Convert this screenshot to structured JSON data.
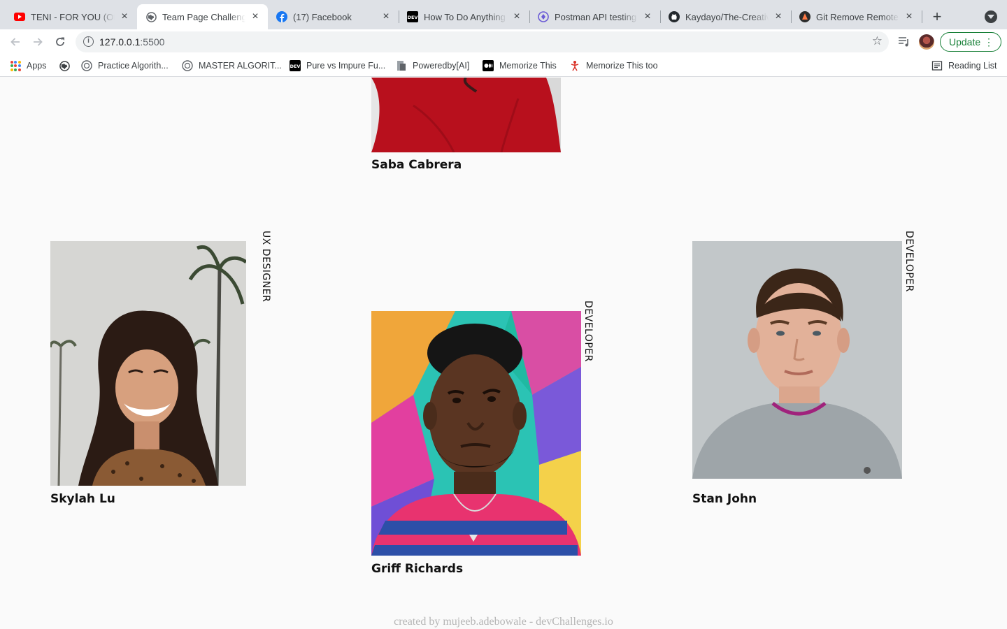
{
  "browser": {
    "tabs": [
      {
        "title": "TENI - FOR YOU (Official",
        "icon": "youtube-icon",
        "active": false
      },
      {
        "title": "Team Page Challenge",
        "icon": "globe-icon",
        "active": true
      },
      {
        "title": "(17) Facebook",
        "icon": "facebook-icon",
        "active": false
      },
      {
        "title": "How To Do Anything in",
        "icon": "dev-icon",
        "active": false
      },
      {
        "title": "Postman API testing w",
        "icon": "postman-icon",
        "active": false
      },
      {
        "title": "Kaydayo/The-Creative",
        "icon": "github-icon",
        "active": false
      },
      {
        "title": "Git Remove Remote: A",
        "icon": "git-icon",
        "active": false
      }
    ],
    "new_tab_label": "+",
    "address": {
      "host": "127.0.0.1",
      "port": ":5500"
    },
    "update_label": "Update",
    "bookmarks": [
      {
        "label": "Apps",
        "icon": "apps-grid-icon"
      },
      {
        "label": "",
        "icon": "globe-icon"
      },
      {
        "label": "Practice Algorith...",
        "icon": "algorithm-icon"
      },
      {
        "label": "MASTER ALGORIT...",
        "icon": "algorithm-icon"
      },
      {
        "label": "Pure vs Impure Fu...",
        "icon": "dev-icon"
      },
      {
        "label": "Poweredby[AI]",
        "icon": "bookmark-page-icon"
      },
      {
        "label": "Memorize This",
        "icon": "medium-icon"
      },
      {
        "label": "Memorize This too",
        "icon": "figure-icon"
      }
    ],
    "reading_list_label": "Reading List"
  },
  "team": {
    "members": [
      {
        "name": "Saba Cabrera",
        "role": ""
      },
      {
        "name": "Skylah Lu",
        "role": "UX DESIGNER"
      },
      {
        "name": "Griff Richards",
        "role": "DEVELOPER"
      },
      {
        "name": "Stan John",
        "role": "DEVELOPER"
      }
    ]
  },
  "footer": {
    "text": "created by mujeeb.adebowale - devChallenges.io"
  },
  "colors": {
    "tabstrip_bg": "#dee1e6",
    "page_bg": "#fafafa",
    "update_green": "#188038",
    "footer_text": "#b5b5b5"
  }
}
